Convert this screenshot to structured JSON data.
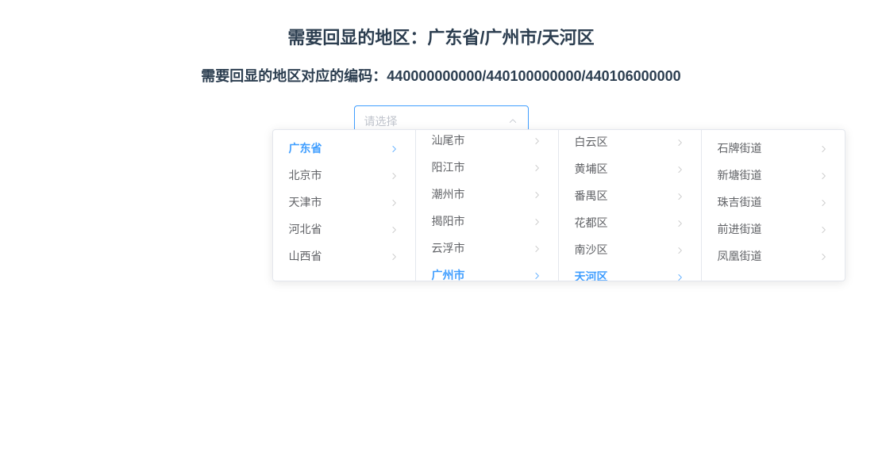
{
  "header": {
    "title_prefix": "需要回显的地区：",
    "title_path": "广东省/广州市/天河区",
    "subtitle_prefix": "需要回显的地区对应的编码：",
    "subtitle_codes": "440000000000/440100000000/440106000000"
  },
  "select": {
    "placeholder": "请选择"
  },
  "cascader": {
    "provinces": [
      {
        "label": "广东省",
        "selected": true,
        "hasChildren": true
      },
      {
        "label": "北京市",
        "selected": false,
        "hasChildren": true
      },
      {
        "label": "天津市",
        "selected": false,
        "hasChildren": true
      },
      {
        "label": "河北省",
        "selected": false,
        "hasChildren": true
      },
      {
        "label": "山西省",
        "selected": false,
        "hasChildren": true
      }
    ],
    "cities": [
      {
        "label": "汕尾市",
        "selected": false,
        "hasChildren": true
      },
      {
        "label": "阳江市",
        "selected": false,
        "hasChildren": true
      },
      {
        "label": "潮州市",
        "selected": false,
        "hasChildren": true
      },
      {
        "label": "揭阳市",
        "selected": false,
        "hasChildren": true
      },
      {
        "label": "云浮市",
        "selected": false,
        "hasChildren": true
      },
      {
        "label": "广州市",
        "selected": true,
        "hasChildren": true
      }
    ],
    "districts": [
      {
        "label": "白云区",
        "selected": false,
        "hasChildren": true
      },
      {
        "label": "黄埔区",
        "selected": false,
        "hasChildren": true
      },
      {
        "label": "番禺区",
        "selected": false,
        "hasChildren": true
      },
      {
        "label": "花都区",
        "selected": false,
        "hasChildren": true
      },
      {
        "label": "南沙区",
        "selected": false,
        "hasChildren": true
      },
      {
        "label": "天河区",
        "selected": true,
        "hasChildren": true
      }
    ],
    "streets": [
      {
        "label": "石牌街道",
        "selected": false,
        "hasChildren": true
      },
      {
        "label": "新塘街道",
        "selected": false,
        "hasChildren": true
      },
      {
        "label": "珠吉街道",
        "selected": false,
        "hasChildren": true
      },
      {
        "label": "前进街道",
        "selected": false,
        "hasChildren": true
      },
      {
        "label": "凤凰街道",
        "selected": false,
        "hasChildren": true
      }
    ]
  }
}
